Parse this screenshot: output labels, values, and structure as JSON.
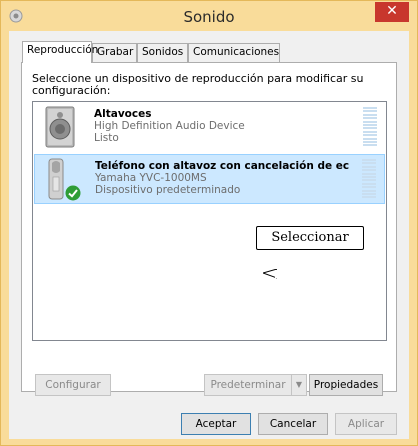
{
  "window": {
    "title": "Sonido",
    "close_glyph": "✕"
  },
  "tabs": [
    {
      "label": "Reproducción",
      "active": true
    },
    {
      "label": "Grabar",
      "active": false
    },
    {
      "label": "Sonidos",
      "active": false
    },
    {
      "label": "Comunicaciones",
      "active": false
    }
  ],
  "panel": {
    "instruction": "Seleccione un dispositivo de reproducción para modificar su configuración:"
  },
  "devices": [
    {
      "name": "Altavoces",
      "description": "High Definition Audio Device",
      "status": "Listo",
      "icon": "speaker-icon",
      "selected": false
    },
    {
      "name": "Teléfono con altavoz con cancelación de ec",
      "description": "Yamaha YVC-1000MS",
      "status": "Dispositivo predeterminado",
      "icon": "speakerphone-icon",
      "selected": true,
      "default_badge_icon": "green-check-icon"
    }
  ],
  "tooltip": {
    "text": "Seleccionar"
  },
  "panel_buttons": {
    "configure": "Configurar",
    "set_default": "Predeterminar",
    "set_default_arrow": "▼",
    "properties": "Propiedades"
  },
  "dialog_buttons": {
    "ok": "Aceptar",
    "cancel": "Cancelar",
    "apply": "Aplicar"
  },
  "colors": {
    "titlebar": "#f9dc9a",
    "close_button": "#c8372d",
    "selection": "#cce8ff"
  }
}
